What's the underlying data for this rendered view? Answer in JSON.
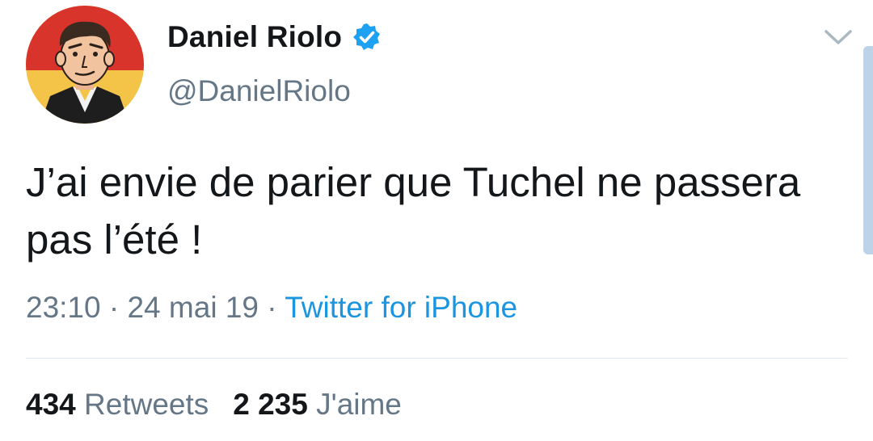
{
  "author": {
    "name": "Daniel Riolo",
    "handle": "@DanielRiolo",
    "verified_icon": "verified-badge-icon",
    "avatar_icon": "cartoon-portrait-avatar"
  },
  "menu": {
    "icon": "chevron-down-icon"
  },
  "tweet": {
    "text": "J’ai envie de parier que Tuchel ne passera pas l’été !",
    "time": "23:10",
    "separator": "·",
    "date": "24 mai 19",
    "source": "Twitter for iPhone"
  },
  "stats": {
    "retweets_count": "434",
    "retweets_label": "Retweets",
    "likes_count": "2 235",
    "likes_label": "J'aime"
  },
  "colors": {
    "text": "#14171a",
    "secondary": "#657786",
    "link": "#1b95e0",
    "divider": "#e1e8ed",
    "verified": "#1da1f2"
  }
}
